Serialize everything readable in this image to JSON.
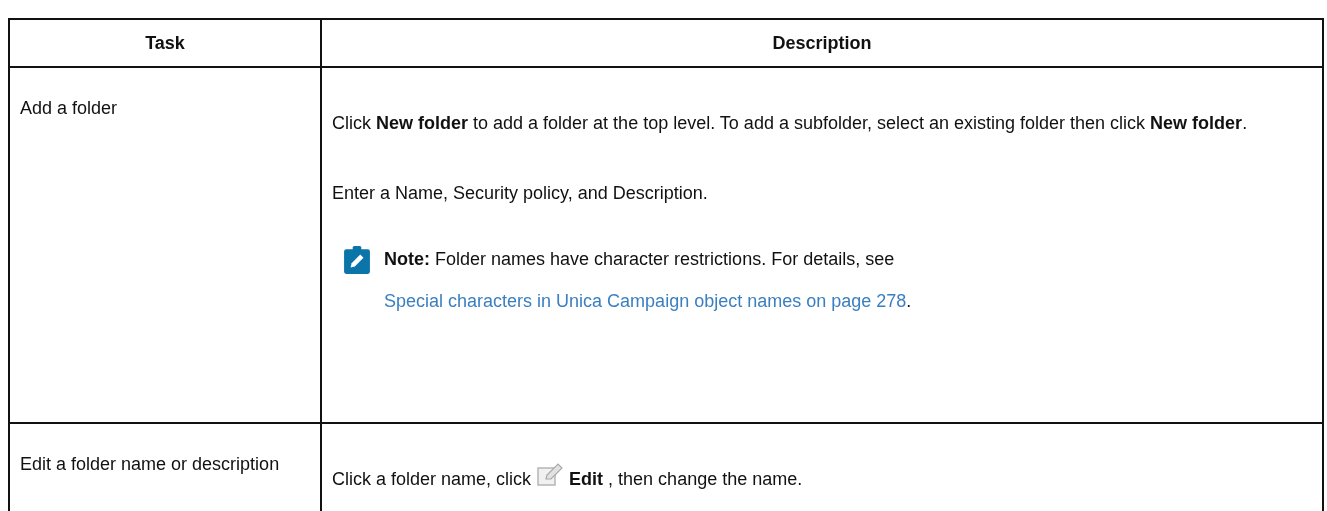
{
  "table": {
    "columns": [
      "Task",
      "Description"
    ],
    "rows": [
      {
        "task": "Add a folder",
        "description": [
          {
            "kind": "paragraph",
            "text": "Click **New folder** to add a folder at the top level. To add a subfolder, select an existing folder then click **New folder**."
          },
          {
            "kind": "paragraph",
            "text": "Enter a Name, Security policy, and Description."
          },
          {
            "kind": "note",
            "text": "**Note:** Folder names have character restrictions. For details, see ",
            "link": "Special characters in Unica Campaign object names on page 278",
            "after": "."
          }
        ]
      },
      {
        "task": "Edit a folder name or description",
        "description": [
          {
            "kind": "icon_paragraph",
            "before": "Click a folder name, click",
            "after": "**Edit** , then change the name."
          }
        ]
      }
    ]
  }
}
